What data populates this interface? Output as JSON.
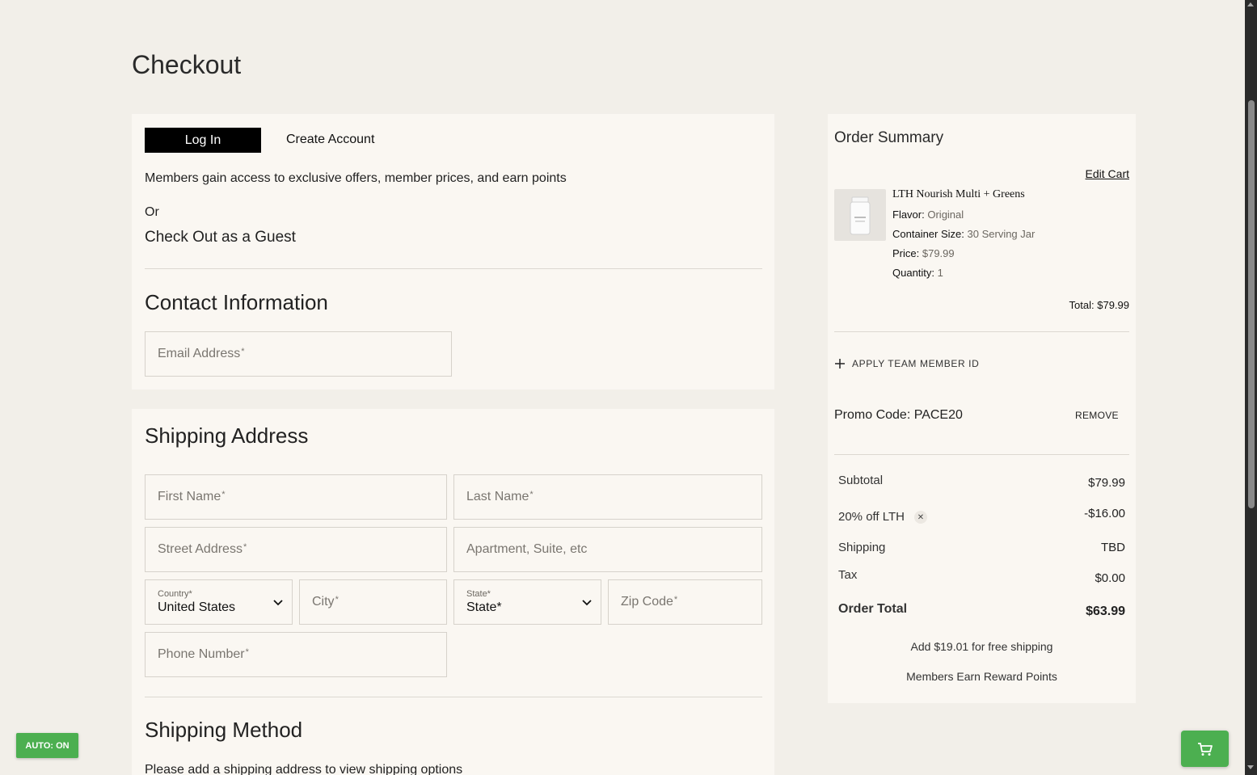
{
  "page": {
    "title": "Checkout"
  },
  "account": {
    "login_label": "Log In",
    "create_account_label": "Create Account",
    "members_text": "Members gain access to exclusive offers, member prices, and earn points",
    "or_text": "Or",
    "guest_text": "Check Out as a Guest"
  },
  "contact": {
    "title": "Contact Information",
    "email_placeholder": "Email Address",
    "required_mark": "*"
  },
  "shipping": {
    "title": "Shipping Address",
    "first_name": "First Name",
    "last_name": "Last Name",
    "street": "Street Address",
    "apartment": "Apartment, Suite, etc",
    "country_label": "Country*",
    "country_value": "United States",
    "city": "City",
    "state_label": "State*",
    "state_value": "State*",
    "zip": "Zip Code",
    "phone": "Phone Number"
  },
  "shipping_method": {
    "title": "Shipping Method",
    "note": "Please add a shipping address to view shipping options"
  },
  "summary": {
    "title": "Order Summary",
    "edit_cart": "Edit Cart",
    "product": {
      "name": "LTH Nourish Multi + Greens",
      "flavor_label": "Flavor:",
      "flavor_value": "Original",
      "size_label": "Container Size:",
      "size_value": "30 Serving Jar",
      "price_label": "Price:",
      "price_value": "$79.99",
      "qty_label": "Quantity:",
      "qty_value": "1",
      "total": "Total: $79.99"
    },
    "apply_team": "APPLY TEAM MEMBER ID",
    "promo": "Promo Code: PACE20",
    "remove": "REMOVE",
    "subtotal_label": "Subtotal",
    "subtotal_value": "$79.99",
    "discount_label": "20% off LTH",
    "discount_value": "-$16.00",
    "shipping_label": "Shipping",
    "shipping_value": "TBD",
    "tax_label": "Tax",
    "tax_value": "$0.00",
    "order_total_label": "Order Total",
    "order_total_value": "$63.99",
    "free_shipping_note": "Add $19.01 for free shipping",
    "reward_note": "Members Earn Reward Points"
  },
  "widgets": {
    "auto_badge": "AUTO: ON"
  },
  "colors": {
    "background": "#f2efe9",
    "panel": "#faf7f2",
    "accent_green": "#4caf50",
    "button_black": "#000000"
  }
}
